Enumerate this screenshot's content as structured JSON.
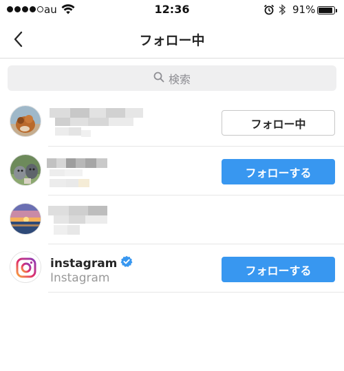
{
  "status_bar": {
    "carrier": "au",
    "time": "12:36",
    "battery_percent": "91%",
    "battery_level": 0.91,
    "signal_bars_filled": 4,
    "signal_bars_total": 5
  },
  "nav": {
    "title": "フォロー中",
    "back_icon": "chevron-left-icon"
  },
  "search": {
    "placeholder": "検索",
    "icon": "search-icon"
  },
  "colors": {
    "follow_button_bg": "#3897f0",
    "verified_badge": "#3897f0",
    "secondary_text": "#999999"
  },
  "users": [
    {
      "username": "",
      "fullname": "",
      "blurred": true,
      "button_label": "フォロー中",
      "button_style": "following"
    },
    {
      "username": "",
      "fullname": "",
      "blurred": true,
      "button_label": "フォローする",
      "button_style": "follow"
    },
    {
      "username": "",
      "fullname": "",
      "blurred": true,
      "button_label": "",
      "button_style": "none"
    },
    {
      "username": "instagram",
      "fullname": "Instagram",
      "blurred": false,
      "verified": true,
      "button_label": "フォローする",
      "button_style": "follow"
    }
  ]
}
